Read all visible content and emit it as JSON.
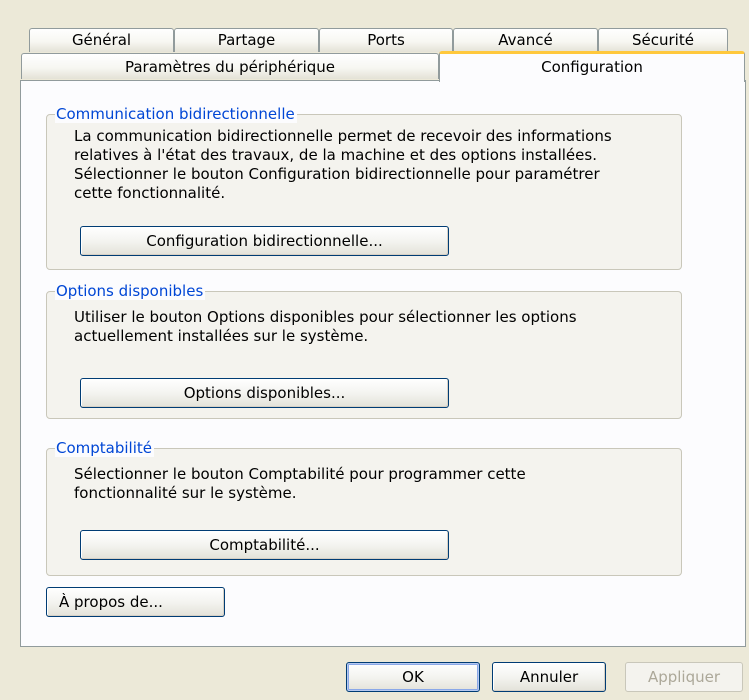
{
  "tabs": {
    "row1": [
      "Général",
      "Partage",
      "Ports",
      "Avancé",
      "Sécurité"
    ],
    "row2": [
      "Paramètres du périphérique",
      "Configuration"
    ],
    "active": "Configuration"
  },
  "groups": {
    "bidirectional": {
      "legend": "Communication bidirectionnelle",
      "text": "La communication bidirectionnelle permet de recevoir des informations\nrelatives à l'état des travaux, de la machine et des options installées.\nSélectionner le bouton Configuration bidirectionnelle pour paramétrer\ncette fonctionnalité.",
      "button": "Configuration bidirectionnelle..."
    },
    "options": {
      "legend": "Options disponibles",
      "text": "Utiliser le bouton Options disponibles pour sélectionner les options\nactuellement installées sur le système.",
      "button": "Options disponibles..."
    },
    "accounting": {
      "legend": "Comptabilité",
      "text": "Sélectionner le bouton Comptabilité pour programmer cette\nfonctionnalité sur le système.",
      "button": "Comptabilité..."
    }
  },
  "about_button": "À propos de...",
  "footer": {
    "ok": "OK",
    "cancel": "Annuler",
    "apply": "Appliquer"
  },
  "colors": {
    "legend": "#0046d5",
    "active_tab_accent": "#ffc83c",
    "dialog_bg": "#ece9d8",
    "button_border": "#003c74"
  }
}
